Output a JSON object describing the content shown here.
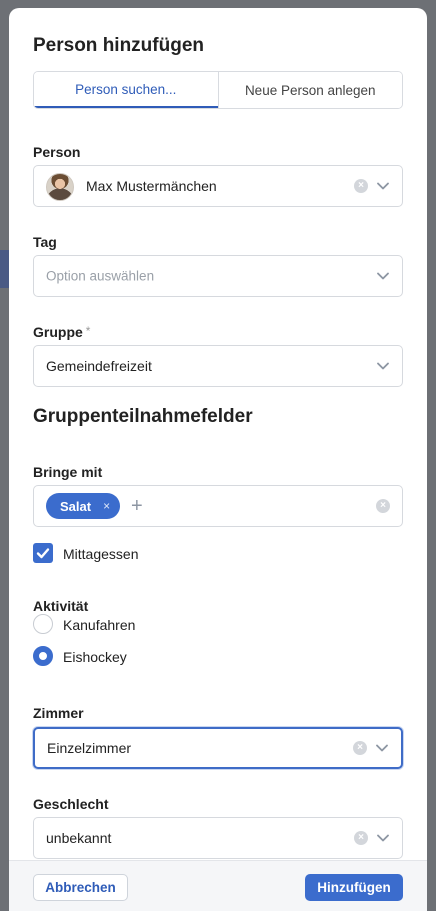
{
  "dialog": {
    "title": "Person hinzufügen",
    "tabs": [
      {
        "label": "Person suchen...",
        "active": true
      },
      {
        "label": "Neue Person anlegen",
        "active": false
      }
    ]
  },
  "person": {
    "label": "Person",
    "value": "Max Mustermänchen"
  },
  "tag": {
    "label": "Tag",
    "placeholder": "Option auswählen"
  },
  "gruppe": {
    "label": "Gruppe",
    "required_marker": "*",
    "value": "Gemeindefreizeit"
  },
  "section": {
    "title": "Gruppenteilnahmefelder"
  },
  "bringe_mit": {
    "label": "Bringe mit",
    "chips": [
      "Salat"
    ],
    "chip_remove": "×",
    "add_symbol": "+"
  },
  "mittagessen": {
    "label": "Mittagessen",
    "checked": true
  },
  "aktivitaet": {
    "label": "Aktivität",
    "options": [
      {
        "label": "Kanufahren",
        "selected": false
      },
      {
        "label": "Eishockey",
        "selected": true
      }
    ]
  },
  "zimmer": {
    "label": "Zimmer",
    "value": "Einzelzimmer"
  },
  "geschlecht": {
    "label": "Geschlecht",
    "value": "unbekannt"
  },
  "footer": {
    "cancel_label": "Abbrechen",
    "add_label": "Hinzufügen"
  },
  "colors": {
    "accent": "#3b6ccd",
    "overlay": "#5e6166"
  },
  "icons": {
    "clear": "clear-icon",
    "chevron": "chevron-down-icon",
    "check": "checkmark-icon",
    "plus": "plus-icon"
  }
}
